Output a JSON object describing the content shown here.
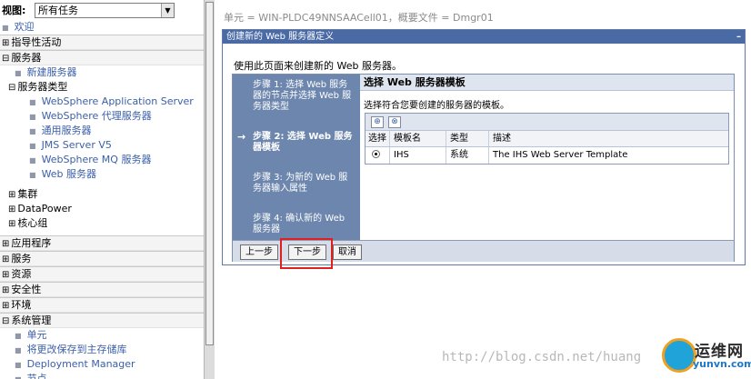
{
  "nav": {
    "view_label": "视图:",
    "view_value": "所有任务",
    "items": [
      {
        "label": "欢迎"
      },
      {
        "label": "指导性活动"
      },
      {
        "label": "服务器"
      },
      {
        "label": "新建服务器"
      },
      {
        "label": "服务器类型"
      },
      {
        "label": "WebSphere Application Server"
      },
      {
        "label": "WebSphere 代理服务器"
      },
      {
        "label": "通用服务器"
      },
      {
        "label": "JMS Server V5"
      },
      {
        "label": "WebSphere MQ 服务器"
      },
      {
        "label": "Web 服务器"
      },
      {
        "label": "集群"
      },
      {
        "label": "DataPower"
      },
      {
        "label": "核心组"
      },
      {
        "label": "应用程序"
      },
      {
        "label": "服务"
      },
      {
        "label": "资源"
      },
      {
        "label": "安全性"
      },
      {
        "label": "环境"
      },
      {
        "label": "系统管理"
      },
      {
        "label": "单元"
      },
      {
        "label": "将更改保存到主存储库"
      },
      {
        "label": "Deployment Manager"
      },
      {
        "label": "节点"
      }
    ]
  },
  "context_line": "单元 = WIN-PLDC49NNSAACell01，概要文件 = Dmgr01",
  "panel": {
    "title": "创建新的 Web 服务器定义",
    "minimize": "–",
    "intro": "使用此页面来创建新的 Web 服务器。"
  },
  "wizard": {
    "steps": [
      {
        "label": "步骤 1: 选择 Web 服务器的节点并选择 Web 服务器类型"
      },
      {
        "label": "步骤 2: 选择 Web 服务器模板"
      },
      {
        "label": "步骤 3: 为新的 Web 服务器输入属性"
      },
      {
        "label": "步骤 4: 确认新的 Web 服务器"
      }
    ],
    "current_arrow": "→",
    "content_title": "选择 Web 服务器模板",
    "content_desc": "选择符合您要创建的服务器的模板。",
    "table": {
      "headers": [
        "选择",
        "模板名",
        "类型",
        "描述"
      ],
      "rows": [
        {
          "name": "IHS",
          "type": "系统",
          "description": "The IHS Web Server Template"
        }
      ]
    },
    "buttons": {
      "prev": "上一步",
      "next": "下一步",
      "cancel": "取消"
    }
  },
  "watermark": {
    "url": "http://blog.csdn.net/huang",
    "logo_name": "运维网",
    "logo_domain": "yunvn.com"
  },
  "colors": {
    "accent": "#4a6aa5",
    "steps_bg": "#6d86ad",
    "highlight": "#e02020",
    "link": "#3b5fa8"
  }
}
